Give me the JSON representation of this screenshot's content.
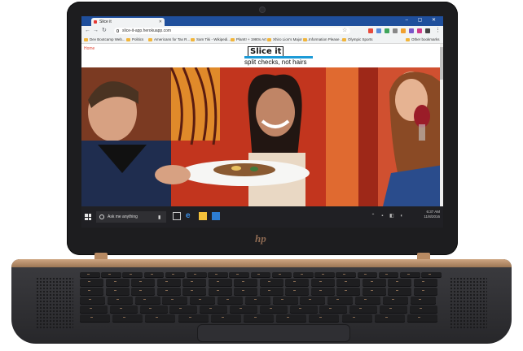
{
  "browser": {
    "tab_title": "Slice it",
    "address": "slice-it-app.herokuapp.com",
    "bookmarks": [
      "Dev Bootcamp Web...",
      "Politics",
      "Americans for Tax R...",
      "Sam Tiki - Wikipedi...",
      "PlanIt! + 1980s Art ...",
      "Xhiro Lion's Major R...",
      "Information Please ...",
      "Olympic Sports",
      "Other bookmarks"
    ]
  },
  "page": {
    "nav_home": "Home",
    "brand_title": "Slice it",
    "tagline": "split checks, not hairs"
  },
  "taskbar": {
    "search_placeholder": "Ask me anything",
    "time": "6:37 AM",
    "date": "11/8/2016"
  },
  "device": {
    "logo": "hp"
  },
  "colors": {
    "chrome_blue": "#1f4f9c",
    "brand_blue": "#1d9bd7",
    "home_link": "#e04a3a",
    "rose_gold": "#b88a62"
  }
}
